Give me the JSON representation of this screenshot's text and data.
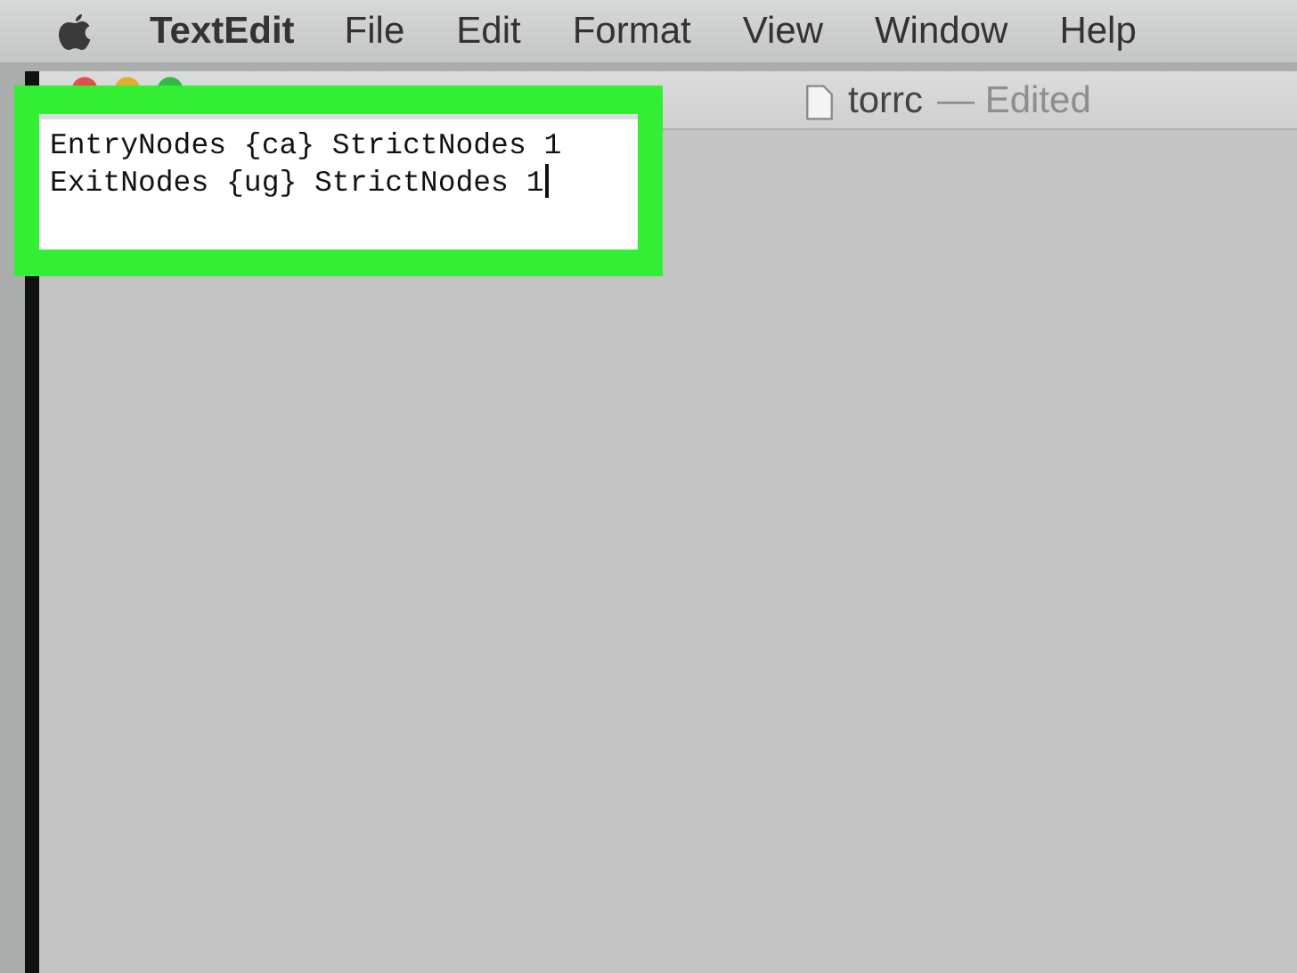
{
  "menu_bar": {
    "app_name": "TextEdit",
    "items": [
      "File",
      "Edit",
      "Format",
      "View",
      "Window",
      "Help"
    ]
  },
  "window": {
    "title": "torrc",
    "title_status": "— Edited"
  },
  "document": {
    "lines": [
      "EntryNodes {ca} StrictNodes 1",
      "ExitNodes {ug} StrictNodes 1"
    ]
  }
}
